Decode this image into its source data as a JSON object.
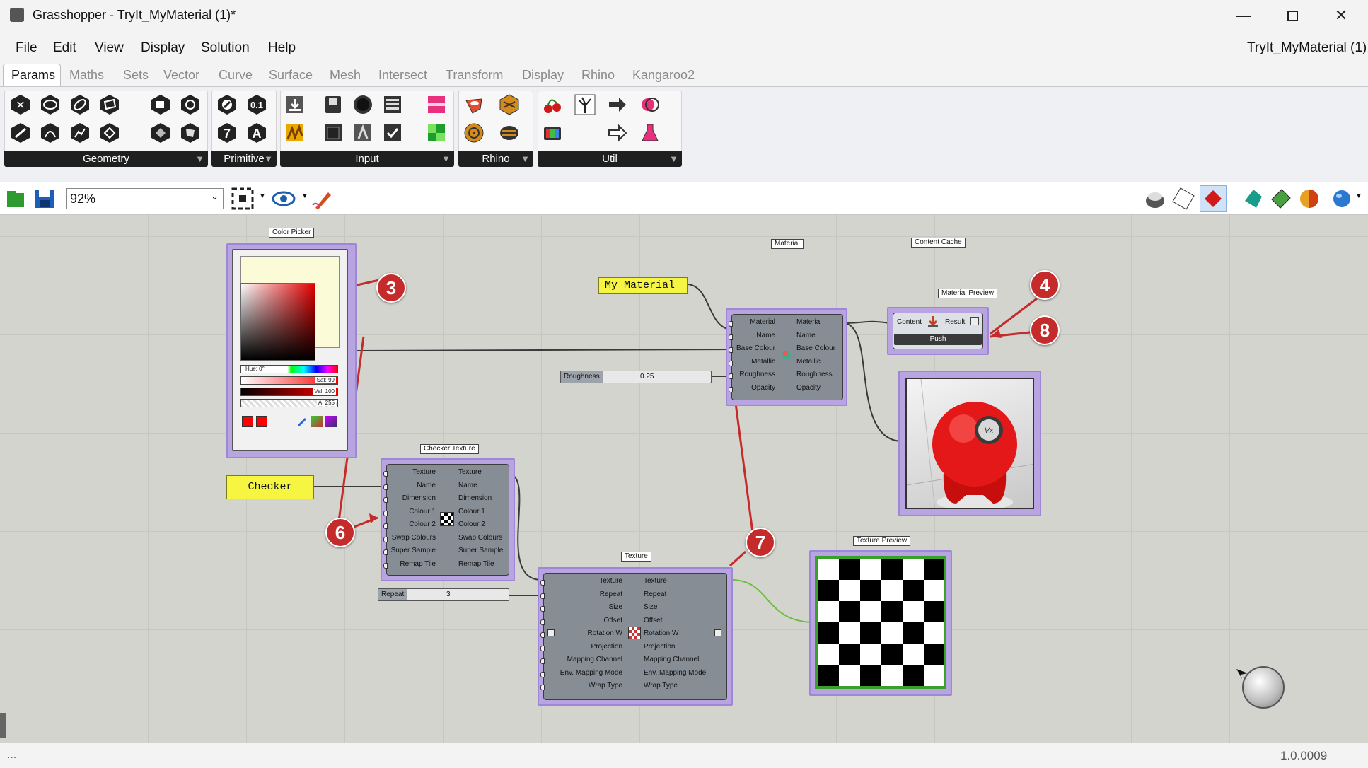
{
  "window": {
    "title": "Grasshopper - TryIt_MyMaterial (1)*",
    "doc_name": "TryIt_MyMaterial (1)"
  },
  "menu": [
    "File",
    "Edit",
    "View",
    "Display",
    "Solution",
    "Help"
  ],
  "tabs": [
    "Params",
    "Maths",
    "Sets",
    "Vector",
    "Curve",
    "Surface",
    "Mesh",
    "Intersect",
    "Transform",
    "Display",
    "Rhino",
    "Kangaroo2"
  ],
  "ribbon": {
    "panels": [
      "Geometry",
      "Primitive",
      "Input",
      "Rhino",
      "Util"
    ]
  },
  "toolbar": {
    "zoom": "92%"
  },
  "components": {
    "color_picker": {
      "tag": "Color Picker",
      "hue": "Hue: 0°",
      "sat": "Sat: 99",
      "val": "Val: 100",
      "alpha": "A: 255"
    },
    "my_material": {
      "text": "My Material"
    },
    "checker": {
      "text": "Checker"
    },
    "material": {
      "tag": "Material",
      "inputs": [
        "Material",
        "Name",
        "Base Colour",
        "Metallic",
        "Roughness",
        "Opacity"
      ],
      "outputs": [
        "Material",
        "Name",
        "Base Colour",
        "Metallic",
        "Roughness",
        "Opacity"
      ]
    },
    "roughness": {
      "label": "Roughness",
      "value": "0.25"
    },
    "content_cache": {
      "tag": "Content Cache",
      "input": "Content",
      "output": "Result",
      "button": "Push"
    },
    "material_preview": {
      "tag": "Material Preview"
    },
    "checker_texture": {
      "tag": "Checker Texture",
      "inputs": [
        "Texture",
        "Name",
        "Dimension",
        "Colour 1",
        "Colour 2",
        "Swap Colours",
        "Super Sample",
        "Remap Tile"
      ],
      "outputs": [
        "Texture",
        "Name",
        "Dimension",
        "Colour 1",
        "Colour 2",
        "Swap Colours",
        "Super Sample",
        "Remap Tile"
      ]
    },
    "texture": {
      "tag": "Texture",
      "inputs": [
        "Texture",
        "Repeat",
        "Size",
        "Offset",
        "Rotation W",
        "Projection",
        "Mapping Channel",
        "Env. Mapping Mode",
        "Wrap Type"
      ],
      "outputs": [
        "Texture",
        "Repeat",
        "Size",
        "Offset",
        "Rotation W",
        "Projection",
        "Mapping Channel",
        "Env. Mapping Mode",
        "Wrap Type"
      ]
    },
    "repeat": {
      "label": "Repeat",
      "value": "3"
    },
    "texture_preview": {
      "tag": "Texture Preview"
    }
  },
  "annotations": [
    "3",
    "4",
    "8",
    "6",
    "7"
  ],
  "status": {
    "version": "1.0.0009",
    "left": "..."
  },
  "colors": {
    "wire": "#3a3a3a",
    "green_wire": "#6abf3c",
    "badge": "#c62b2b",
    "selection": "#b8a4e0"
  }
}
